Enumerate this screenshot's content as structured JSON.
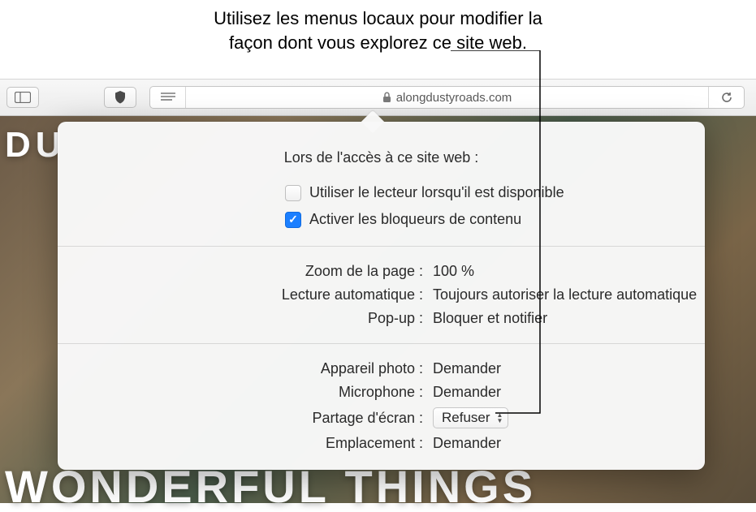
{
  "annotation": {
    "line1": "Utilisez les menus locaux pour modifier la",
    "line2": "façon dont vous explorez ce site web."
  },
  "toolbar": {
    "url": "alongdustyroads.com"
  },
  "background": {
    "top_text": "DU",
    "bottom_text": "WONDERFUL THINGS"
  },
  "popover": {
    "header": "Lors de l'accès à ce site web :",
    "use_reader": {
      "label": "Utiliser le lecteur lorsqu'il est disponible",
      "checked": false
    },
    "content_blockers": {
      "label": "Activer les bloqueurs de contenu",
      "checked": true
    },
    "settings": {
      "zoom": {
        "label": "Zoom de la page :",
        "value": "100 %"
      },
      "autoplay": {
        "label": "Lecture automatique :",
        "value": "Toujours autoriser la lecture automatique"
      },
      "popup": {
        "label": "Pop-up :",
        "value": "Bloquer et notifier"
      },
      "camera": {
        "label": "Appareil photo :",
        "value": "Demander"
      },
      "microphone": {
        "label": "Microphone :",
        "value": "Demander"
      },
      "screen_share": {
        "label": "Partage d'écran :",
        "value": "Refuser"
      },
      "location": {
        "label": "Emplacement :",
        "value": "Demander"
      }
    }
  }
}
